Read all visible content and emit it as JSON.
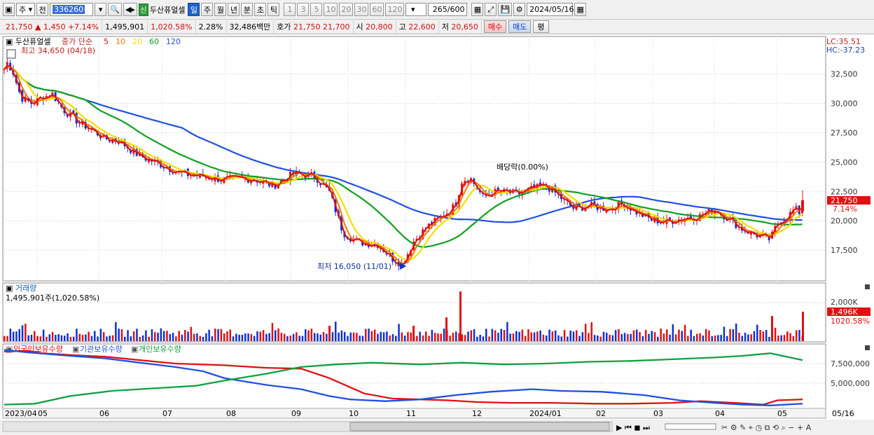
{
  "toolbar": {
    "market": "주",
    "prev_label": "전",
    "code": "336260",
    "stock_name": "두산퓨얼셀",
    "shin_badge": "신",
    "periods": [
      "일",
      "주",
      "월",
      "년",
      "분",
      "초",
      "틱"
    ],
    "active_period": "일",
    "intervals": [
      "1",
      "3",
      "5",
      "10",
      "20",
      "30",
      "60",
      "120"
    ],
    "count": "265",
    "total": "/600",
    "date": "2024/05/16"
  },
  "quote": {
    "price": "21,750",
    "arrow": "▲",
    "change": "1,450",
    "change_pct": "+7.14%",
    "volume": "1,495,901",
    "volume_ratio": "1,020.58%",
    "turnover": "2.28%",
    "amount": "32,486백만",
    "ask_label": "호가",
    "ask": "21,750",
    "bid": "21,700",
    "open_label": "시",
    "open": "20,800",
    "high_label": "고",
    "high": "22,600",
    "low_label": "저",
    "low": "20,650",
    "buy_label": "매수",
    "sell_label": "매도",
    "avg_label": "평"
  },
  "price_panel": {
    "title": "두산퓨얼셀",
    "legend_label": "종가 단순",
    "ma_labels": [
      "5",
      "10",
      "20",
      "60",
      "120"
    ],
    "high_note": "최고 34,650 (04/18)",
    "low_note": "최저 16,050 (11/01)",
    "dividend_note": "배당락(0.00%)",
    "lc": "LC:35.51",
    "hc": "HC:-37.23",
    "y_ticks": [
      "32,500",
      "30,000",
      "27,500",
      "25,000",
      "22,500",
      "20,000",
      "17,500"
    ],
    "price_tag": "21,750",
    "pct_tag": "7.14%"
  },
  "volume_panel": {
    "title": "거래량",
    "subtitle": "1,495,901주(1,020.58%)",
    "y_ticks": [
      "2,000K"
    ],
    "vol_tag": "1,496K",
    "ratio_tag": "1020.58%"
  },
  "holdings_panel": {
    "legends": [
      "외국인보유수량",
      "기관보유수량",
      "개인보유수량"
    ],
    "y_ticks": [
      "7,500,000",
      "5,000,000"
    ]
  },
  "x_axis": {
    "labels": [
      "2023/04",
      "05",
      "06",
      "07",
      "08",
      "09",
      "10",
      "11",
      "12",
      "2024/01",
      "02",
      "03",
      "04",
      "05"
    ],
    "right_label": "05/16"
  },
  "colors": {
    "up": "#e01010",
    "down": "#1030d0",
    "ma5": "#e01010",
    "ma10": "#f07a00",
    "ma20": "#f2df00",
    "ma60": "#10a020",
    "ma120": "#2050e0",
    "foreign": "#e01010",
    "inst": "#2050e0",
    "retail": "#10a040"
  }
}
